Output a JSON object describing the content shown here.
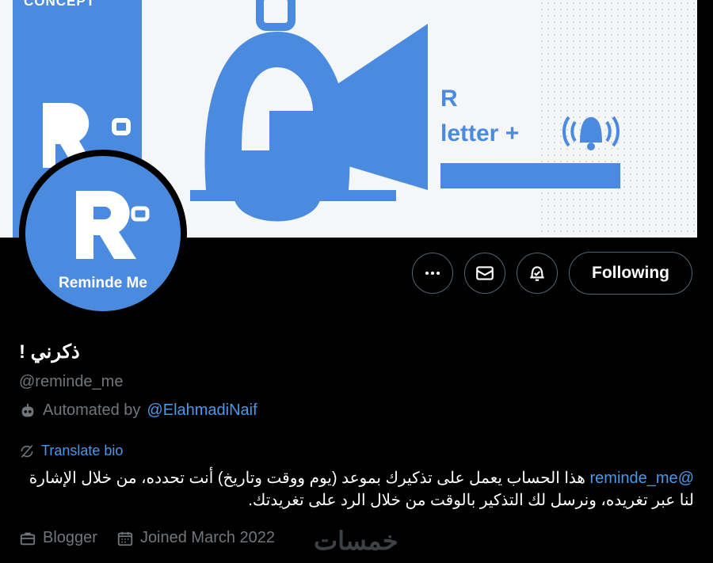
{
  "banner": {
    "concept_text": "CONCEPT",
    "r_text": "R",
    "letter_text": "letter +",
    "colors": {
      "brand_blue": "#4a8be0",
      "background": "#f5f6f7"
    }
  },
  "avatar": {
    "label": "Reminde Me"
  },
  "actions": {
    "more_icon": "more-icon",
    "message_icon": "mail-icon",
    "notify_icon": "bell-icon",
    "follow_label": "Following"
  },
  "profile": {
    "display_name": "! ذكرني",
    "handle": "@reminde_me",
    "automated_prefix": "Automated by",
    "automated_by": "@ElahmadiNaif",
    "translate_label": "Translate bio",
    "bio_mention": "@reminde_me",
    "bio_text": " هذا الحساب يعمل على تذكيرك بموعد (يوم ووقت وتاريخ) أنت تحدده، من خلال الإشارة لنا عبر تغريده، ونرسل لك التذكير بالوقت من خلال الرد على تغريدتك.",
    "category": "Blogger",
    "joined": "Joined March 2022"
  },
  "watermark": "خمسات"
}
